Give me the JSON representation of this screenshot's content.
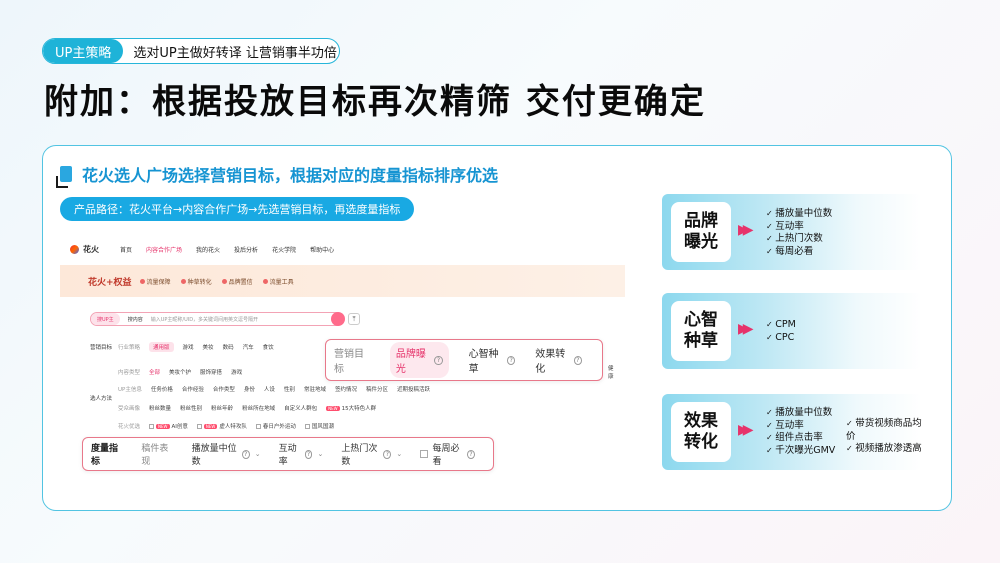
{
  "tag": {
    "pill": "UP主策略",
    "text": "选对UP主做好转译 让营销事半功倍"
  },
  "title": "附加：根据投放目标再次精筛 交付更确定",
  "subtitle": "花火选人广场选择营销目标，根据对应的度量指标排序优选",
  "path": "产品路径：花火平台→内容合作广场→先选营销目标，再选度量指标",
  "screenshot": {
    "logo": "花火",
    "nav": [
      "首页",
      "内容合作广场",
      "我的花火",
      "投后分析",
      "花火学院",
      "帮助中心"
    ],
    "rights_brand": "花火+权益",
    "rights": [
      "流量保障",
      "种草转化",
      "品牌置信",
      "流量工具"
    ],
    "search_tab1": "搜UP主",
    "search_tab2": "搜内容",
    "search_placeholder": "输入UP主昵称/UID，多关键词间用英文逗号隔开",
    "row1_label": "营销目标",
    "row1_items": [
      "行业策略",
      "通用版",
      "游戏",
      "美妆",
      "数码",
      "汽车",
      "食饮"
    ],
    "row2_items": [
      "内容类型",
      "全部",
      "美妆个护",
      "服饰穿搭",
      "游戏"
    ],
    "row3_items": [
      "UP主信息",
      "任务价格",
      "合作经验",
      "合作类型",
      "身份",
      "人设",
      "性别",
      "常驻地域",
      "签约情况",
      "稿件分区",
      "近期投稿活跃"
    ],
    "row4_items": [
      "受众画像",
      "粉丝数量",
      "粉丝性别",
      "粉丝年龄",
      "粉丝所在地域",
      "自定义人群包",
      "15大特色人群"
    ],
    "row5_items": [
      "花火优选",
      "AI创意",
      "虚人特攻队",
      "春日户外运动",
      "国风国潮"
    ],
    "side_label": "选人方法",
    "extra_right": "健康"
  },
  "callout_goal": {
    "label": "营销目标",
    "options": [
      {
        "text": "品牌曝光",
        "active": true
      },
      {
        "text": "心智种草",
        "active": false
      },
      {
        "text": "效果转化",
        "active": false
      }
    ]
  },
  "callout_metric": {
    "label": "度量指标",
    "muted": "稿件表现",
    "options": [
      "播放量中位数",
      "互动率",
      "上热门次数",
      "每周必看"
    ]
  },
  "cards": [
    {
      "title_l1": "品牌",
      "title_l2": "曝光",
      "items": [
        "播放量中位数",
        "互动率",
        "上热门次数",
        "每周必看"
      ],
      "items2": []
    },
    {
      "title_l1": "心智",
      "title_l2": "种草",
      "items": [
        "CPM",
        "CPC"
      ],
      "items2": []
    },
    {
      "title_l1": "效果",
      "title_l2": "转化",
      "items": [
        "播放量中位数",
        "互动率",
        "组件点击率",
        "千次曝光GMV"
      ],
      "items2": [
        "带货视频商品均价",
        "视频播放渗透高"
      ]
    }
  ]
}
